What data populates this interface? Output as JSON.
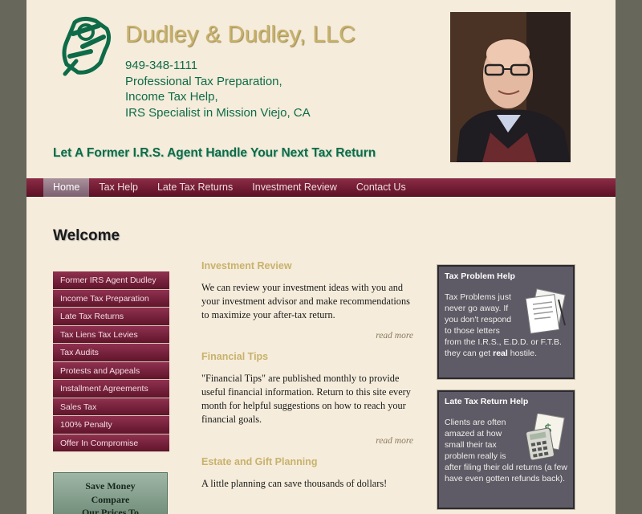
{
  "header": {
    "title": "Dudley & Dudley, LLC",
    "phone": "949-348-1111",
    "line2": "Professional Tax Preparation,",
    "line3": "Income Tax Help,",
    "line4": "IRS Specialist in Mission Viejo, CA",
    "slogan": "Let A Former I.R.S. Agent Handle Your Next Tax Return"
  },
  "nav": {
    "items": [
      "Home",
      "Tax Help",
      "Late Tax Returns",
      "Investment Review",
      "Contact Us"
    ]
  },
  "page": {
    "heading": "Welcome"
  },
  "sidebar": {
    "items": [
      "Former IRS Agent Dudley",
      "Income Tax Preparation",
      "Late Tax Returns",
      "Tax Liens Tax Levies",
      "Tax Audits",
      "Protests and Appeals",
      "Installment Agreements",
      "Sales Tax",
      "100% Penalty",
      "Offer In Compromise"
    ],
    "promo_line1": "Save Money",
    "promo_line2": "Compare",
    "promo_line3": "Our Prices To"
  },
  "main": {
    "sections": [
      {
        "title": "Investment Review",
        "body": "We can review your investment ideas with you and your investment advisor and make recommendations to maximize your after-tax return.",
        "more": "read more"
      },
      {
        "title": "Financial Tips",
        "body": "\"Financial Tips\" are published monthly to provide useful financial information. Return to this site every month for helpful suggestions on how to reach your financial goals.",
        "more": "read more"
      },
      {
        "title": "Estate and Gift Planning",
        "body": "A little planning can save thousands of dollars!"
      }
    ]
  },
  "right": {
    "box1": {
      "title": "Tax Problem Help",
      "text_before": "Tax Problems just never go away. If you don't respond to those letters from the I.R.S., E.D.D. or F.T.B. they can get ",
      "text_bold": "real",
      "text_after": " hostile."
    },
    "box2": {
      "title": "Late Tax Return Help",
      "text": "Clients are often amazed at how small their tax problem really is after filing their old returns (a few have even gotten refunds back)."
    }
  },
  "colors": {
    "accent_green": "#0e6b47",
    "nav_maroon": "#6e1a33",
    "title_gold": "#c8b26c"
  }
}
